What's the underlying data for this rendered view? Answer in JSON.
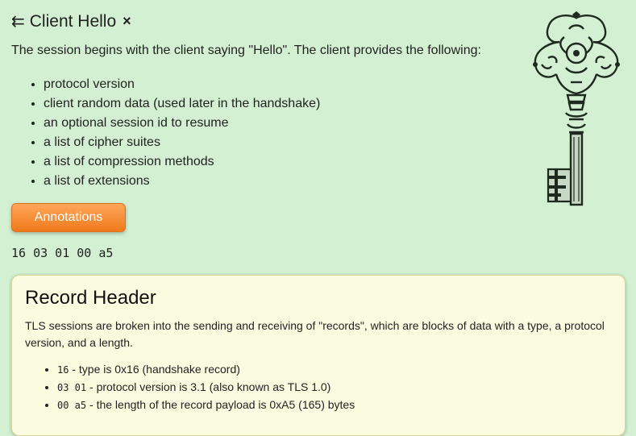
{
  "header": {
    "icon": "⇇",
    "title": "Client Hello",
    "close_glyph": "×"
  },
  "intro": "The session begins with the client saying \"Hello\". The client provides the following:",
  "fields": [
    "protocol version",
    "client random data (used later in the handshake)",
    "an optional session id to resume",
    "a list of cipher suites",
    "a list of compression methods",
    "a list of extensions"
  ],
  "annotations_button": "Annotations",
  "hex_bytes": "16 03 01 00 a5",
  "record_header": {
    "title": "Record Header",
    "description": "TLS sessions are broken into the sending and receiving of \"records\", which are blocks of data with a type, a protocol version, and a length.",
    "items": [
      {
        "code": "16",
        "text": " - type is 0x16 (handshake record)"
      },
      {
        "code": "03 01",
        "text": " - protocol version is 3.1 (also known as TLS 1.0)"
      },
      {
        "code": "00 a5",
        "text": " - the length of the record payload is 0xA5 (165) bytes"
      }
    ]
  },
  "colors": {
    "background": "#d3f0d3",
    "button": "#f5892c",
    "card": "#fbfbdf"
  }
}
